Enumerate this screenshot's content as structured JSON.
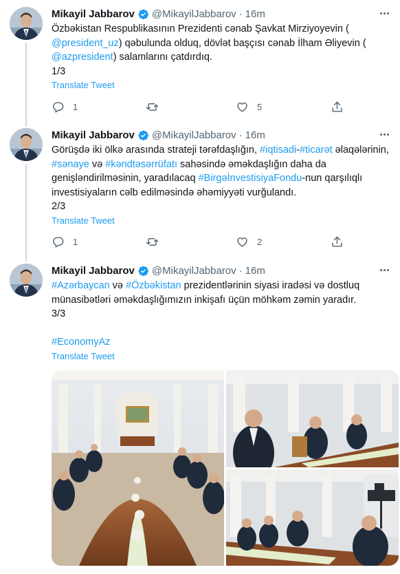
{
  "tweets": [
    {
      "name": "Mikayil Jabbarov",
      "handle": "@MikayilJabbarov",
      "separator": "·",
      "time": "16m",
      "lines": [
        [
          {
            "t": "Özbəkistan Respublikasının Prezidenti cənab Şavkat Mirziyoyevin ("
          }
        ],
        [
          {
            "t": "@president_uz",
            "link": true
          },
          {
            "t": ") qəbulunda olduq, dövlət başçısı cənab İlham Əliyevin ("
          }
        ],
        [
          {
            "t": "@azpresident",
            "link": true
          },
          {
            "t": ") salamlarını çatdırdıq."
          }
        ],
        [
          {
            "t": "1/3"
          }
        ]
      ],
      "translate": "Translate Tweet",
      "replies": "1",
      "retweets": "",
      "likes": "5"
    },
    {
      "name": "Mikayil Jabbarov",
      "handle": "@MikayilJabbarov",
      "separator": "·",
      "time": "16m",
      "lines": [
        [
          {
            "t": "Görüşdə iki ölkə arasında strateji tərəfdaşlığın, "
          },
          {
            "t": "#iqtisadi",
            "link": true
          },
          {
            "t": "-"
          },
          {
            "t": "#ticarət",
            "link": true
          },
          {
            "t": " əlaqələrinin,"
          }
        ],
        [
          {
            "t": "#sənaye",
            "link": true
          },
          {
            "t": " və "
          },
          {
            "t": "#kəndtəsərrüfatı",
            "link": true
          },
          {
            "t": " sahəsində əməkdaşlığın daha da"
          }
        ],
        [
          {
            "t": "genişləndirilməsinin, yaradılacaq "
          },
          {
            "t": "#BirgəİnvestisiyaFondu",
            "link": true
          },
          {
            "t": "-nun qarşılıqlı"
          }
        ],
        [
          {
            "t": "investisiyaların cəlb edilməsində əhəmiyyəti vurğulandı."
          }
        ],
        [
          {
            "t": "2/3"
          }
        ]
      ],
      "translate": "Translate Tweet",
      "replies": "1",
      "retweets": "",
      "likes": "2"
    },
    {
      "name": "Mikayil Jabbarov",
      "handle": "@MikayilJabbarov",
      "separator": "·",
      "time": "16m",
      "lines": [
        [
          {
            "t": "#Azərbaycan",
            "link": true
          },
          {
            "t": " və "
          },
          {
            "t": "#Özbəkistan",
            "link": true
          },
          {
            "t": " prezidentlərinin siyasi iradəsi və dostluq"
          }
        ],
        [
          {
            "t": "münasibətləri əməkdaşlığımızın inkişafı üçün möhkəm zəmin yaradır."
          }
        ],
        [
          {
            "t": "3/3"
          }
        ],
        [
          {
            "t": " "
          }
        ],
        [
          {
            "t": "#EconomyAz",
            "link": true
          }
        ]
      ],
      "translate": "Translate Tweet"
    }
  ],
  "icons": {
    "verified": "verified-badge-icon",
    "more": "more-options-icon",
    "reply": "reply-icon",
    "retweet": "retweet-icon",
    "like": "like-icon",
    "share": "share-icon"
  },
  "colors": {
    "accent": "#1d9bf0",
    "text": "#0f1419",
    "secondary": "#536471",
    "thread_line": "#cfd9de"
  }
}
